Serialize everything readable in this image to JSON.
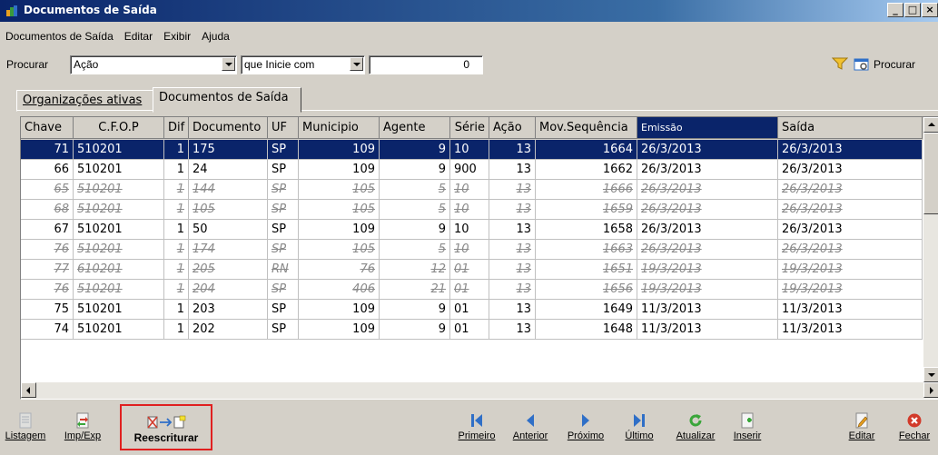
{
  "window": {
    "title": "Documentos de Saída",
    "buttons": [
      "_",
      "□",
      "×"
    ]
  },
  "menu": [
    "Documentos de Saída",
    "Editar",
    "Exibir",
    "Ajuda"
  ],
  "search": {
    "label": "Procurar",
    "field": "Ação",
    "mode": "que Inicie com",
    "value": "0",
    "button": "Procurar"
  },
  "tabs": [
    {
      "label": "Organizações ativas",
      "active": false
    },
    {
      "label": "Documentos de Saída",
      "active": true
    }
  ],
  "grid": {
    "columns": [
      "Chave",
      "C.F.O.P",
      "Dif",
      "Documento",
      "UF",
      "Municipio",
      "Agente",
      "Série",
      "Ação",
      "Mov.Sequência",
      "Emissão",
      "Saída"
    ],
    "sorted_column": "Emissão",
    "rows": [
      {
        "chave": "71",
        "cfop": "510201",
        "dif": "1",
        "doc": "175",
        "uf": "SP",
        "mun": "109",
        "agente": "9",
        "serie": "10",
        "acao": "13",
        "mov": "1664",
        "emissao": "26/3/2013",
        "saida": "26/3/2013",
        "state": "selected"
      },
      {
        "chave": "66",
        "cfop": "510201",
        "dif": "1",
        "doc": "24",
        "uf": "SP",
        "mun": "109",
        "agente": "9",
        "serie": "900",
        "acao": "13",
        "mov": "1662",
        "emissao": "26/3/2013",
        "saida": "26/3/2013",
        "state": "normal"
      },
      {
        "chave": "65",
        "cfop": "510201",
        "dif": "1",
        "doc": "144",
        "uf": "SP",
        "mun": "105",
        "agente": "5",
        "serie": "10",
        "acao": "13",
        "mov": "1666",
        "emissao": "26/3/2013",
        "saida": "26/3/2013",
        "state": "deleted"
      },
      {
        "chave": "68",
        "cfop": "510201",
        "dif": "1",
        "doc": "105",
        "uf": "SP",
        "mun": "105",
        "agente": "5",
        "serie": "10",
        "acao": "13",
        "mov": "1659",
        "emissao": "26/3/2013",
        "saida": "26/3/2013",
        "state": "deleted"
      },
      {
        "chave": "67",
        "cfop": "510201",
        "dif": "1",
        "doc": "50",
        "uf": "SP",
        "mun": "109",
        "agente": "9",
        "serie": "10",
        "acao": "13",
        "mov": "1658",
        "emissao": "26/3/2013",
        "saida": "26/3/2013",
        "state": "normal"
      },
      {
        "chave": "76",
        "cfop": "510201",
        "dif": "1",
        "doc": "174",
        "uf": "SP",
        "mun": "105",
        "agente": "5",
        "serie": "10",
        "acao": "13",
        "mov": "1663",
        "emissao": "26/3/2013",
        "saida": "26/3/2013",
        "state": "deleted"
      },
      {
        "chave": "77",
        "cfop": "610201",
        "dif": "1",
        "doc": "205",
        "uf": "RN",
        "mun": "76",
        "agente": "12",
        "serie": "01",
        "acao": "13",
        "mov": "1651",
        "emissao": "19/3/2013",
        "saida": "19/3/2013",
        "state": "deleted"
      },
      {
        "chave": "76",
        "cfop": "510201",
        "dif": "1",
        "doc": "204",
        "uf": "SP",
        "mun": "406",
        "agente": "21",
        "serie": "01",
        "acao": "13",
        "mov": "1656",
        "emissao": "19/3/2013",
        "saida": "19/3/2013",
        "state": "deleted"
      },
      {
        "chave": "75",
        "cfop": "510201",
        "dif": "1",
        "doc": "203",
        "uf": "SP",
        "mun": "109",
        "agente": "9",
        "serie": "01",
        "acao": "13",
        "mov": "1649",
        "emissao": "11/3/2013",
        "saida": "11/3/2013",
        "state": "normal"
      },
      {
        "chave": "74",
        "cfop": "510201",
        "dif": "1",
        "doc": "202",
        "uf": "SP",
        "mun": "109",
        "agente": "9",
        "serie": "01",
        "acao": "13",
        "mov": "1648",
        "emissao": "11/3/2013",
        "saida": "11/3/2013",
        "state": "normal"
      }
    ]
  },
  "toolbar": {
    "listagem": "Listagem",
    "impexp": "Imp/Exp",
    "reescriturar": "Reescriturar",
    "primeiro": "Primeiro",
    "anterior": "Anterior",
    "proximo": "Próximo",
    "ultimo": "Último",
    "atualizar": "Atualizar",
    "inserir": "Inserir",
    "editar": "Editar",
    "fechar": "Fechar"
  },
  "colors": {
    "selection": "#0a246a",
    "highlight_border": "#e02020",
    "nav_icon": "#2f6fc7",
    "refresh_icon": "#3aa63a",
    "close_icon": "#d23a2a"
  }
}
